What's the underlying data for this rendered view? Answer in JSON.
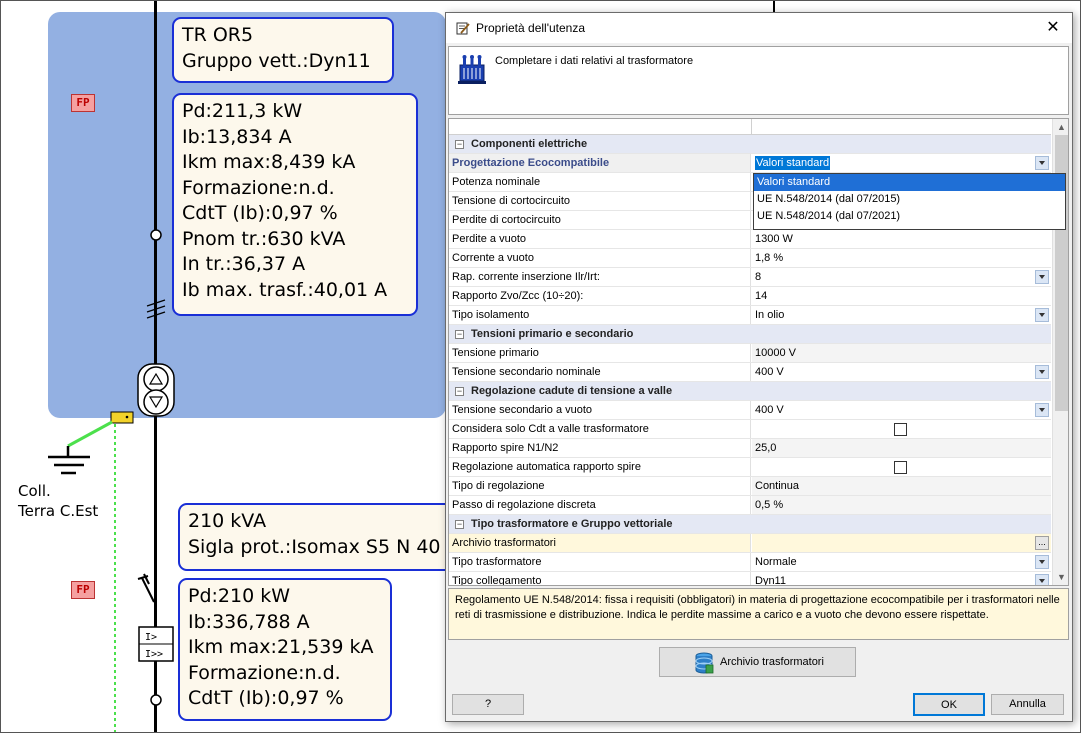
{
  "schematic": {
    "transformer_box": [
      "TR OR5",
      "Gruppo vett.:Dyn11"
    ],
    "upper_results": [
      "Pd:211,3 kW",
      "Ib:13,834 A",
      "Ikm max:8,439 kA",
      "Formazione:n.d.",
      "CdtT (Ib):0,97 %",
      "Pnom tr.:630 kVA",
      "In tr.:36,37 A",
      "Ib max. trasf.:40,01 A"
    ],
    "protection_box": [
      "210 kVA",
      "Sigla prot.:Isomax S5 N 40"
    ],
    "lower_results": [
      "Pd:210 kW",
      "Ib:336,788 A",
      "Ikm max:21,539 kA",
      "Formazione:n.d.",
      "CdtT (Ib):0,97 %"
    ],
    "fp_label": "FP",
    "earth_label": [
      "Coll.",
      "Terra C.Est"
    ],
    "colors": {
      "zone": "#93b0e2",
      "box_border": "#1a2fd6",
      "box_fill": "#fdf8ec",
      "earth_line": "#4ce04c"
    }
  },
  "dialog": {
    "title": "Proprietà dell'utenza",
    "close_glyph": "✕",
    "header_text": "Completare i dati relativi al trasformatore",
    "categories": {
      "c1": "Componenti elettriche",
      "c2": "Tensioni primario e secondario",
      "c3": "Regolazione cadute di tensione a valle",
      "c4": "Tipo trasformatore e Gruppo vettoriale"
    },
    "rows": {
      "r1": {
        "name": "Progettazione Ecocompatibile",
        "value": "Valori standard"
      },
      "r2": {
        "name": "Potenza nominale",
        "value": ""
      },
      "r3": {
        "name": "Tensione di cortocircuito",
        "value": ""
      },
      "r4": {
        "name": "Perdite di cortocircuito",
        "value": ""
      },
      "r5": {
        "name": "Perdite a vuoto",
        "value": "1300 W"
      },
      "r6": {
        "name": "Corrente a vuoto",
        "value": "1,8 %"
      },
      "r7": {
        "name": "Rap. corrente inserzione Ilr/Irt:",
        "value": "8"
      },
      "r8": {
        "name": "Rapporto Zvo/Zcc (10÷20):",
        "value": "14"
      },
      "r9": {
        "name": "Tipo isolamento",
        "value": "In olio"
      },
      "r10": {
        "name": "Tensione primario",
        "value": "10000 V"
      },
      "r11": {
        "name": "Tensione secondario nominale",
        "value": "400 V"
      },
      "r12": {
        "name": "Tensione secondario a vuoto",
        "value": "400 V"
      },
      "r13": {
        "name": "Considera solo Cdt a valle trasformatore",
        "value": ""
      },
      "r14": {
        "name": "Rapporto spire N1/N2",
        "value": "25,0"
      },
      "r15": {
        "name": "Regolazione automatica rapporto spire",
        "value": ""
      },
      "r16": {
        "name": "Tipo di regolazione",
        "value": "Continua"
      },
      "r17": {
        "name": "Passo di regolazione discreta",
        "value": "0,5 %"
      },
      "r18": {
        "name": "Archivio trasformatori",
        "value": ""
      },
      "r19": {
        "name": "Tipo trasformatore",
        "value": "Normale"
      },
      "r20": {
        "name": "Tipo collegamento",
        "value": "Dyn11"
      }
    },
    "dropdown_options": [
      "Valori standard",
      "UE N.548/2014 (dal 07/2015)",
      "UE N.548/2014 (dal 07/2021)"
    ],
    "ellipsis": "...",
    "description": "Regolamento UE N.548/2014: fissa i requisiti (obbligatori) in materia di progettazione ecocompatibile per i trasformatori nelle reti di trasmissione e distribuzione. Indica le perdite massime a carico e a vuoto che devono essere rispettate.",
    "buttons": {
      "archive": "Archivio trasformatori",
      "help": "?",
      "ok": "OK",
      "cancel": "Annulla"
    }
  }
}
